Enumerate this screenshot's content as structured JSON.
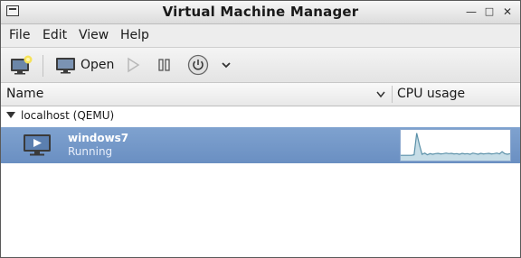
{
  "window": {
    "title": "Virtual Machine Manager"
  },
  "menu": {
    "items": [
      {
        "label": "File"
      },
      {
        "label": "Edit"
      },
      {
        "label": "View"
      },
      {
        "label": "Help"
      }
    ]
  },
  "toolbar": {
    "open_label": "Open"
  },
  "columns": {
    "name": "Name",
    "cpu": "CPU usage"
  },
  "group": {
    "label": "localhost (QEMU)"
  },
  "vm": {
    "name": "windows7",
    "status": "Running",
    "cpu_history": [
      0.18,
      0.18,
      0.18,
      0.18,
      0.18,
      0.2,
      0.95,
      0.55,
      0.22,
      0.26,
      0.2,
      0.24,
      0.22,
      0.24,
      0.25,
      0.23,
      0.24,
      0.26,
      0.24,
      0.25,
      0.23,
      0.24,
      0.22,
      0.25,
      0.23,
      0.24,
      0.22,
      0.26,
      0.24,
      0.22,
      0.25,
      0.23,
      0.24,
      0.25,
      0.23,
      0.24,
      0.26,
      0.23,
      0.31,
      0.24,
      0.22,
      0.24
    ]
  },
  "colors": {
    "selection": "#7398c8",
    "graph_line": "#5a90a8",
    "graph_fill": "#c6dde7"
  }
}
